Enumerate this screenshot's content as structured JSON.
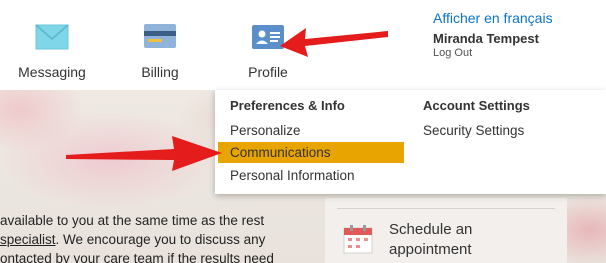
{
  "header": {
    "nav": [
      {
        "label": "Messaging",
        "icon": "envelope-icon"
      },
      {
        "label": "Billing",
        "icon": "credit-card-icon"
      },
      {
        "label": "Profile",
        "icon": "id-card-icon"
      }
    ],
    "language_link": "Afficher en français",
    "user_name": "Miranda Tempest",
    "logout": "Log Out"
  },
  "dropdown": {
    "preferences_heading": "Preferences & Info",
    "account_heading": "Account Settings",
    "preferences_items": [
      "Personalize",
      "Communications",
      "Personal Information"
    ],
    "account_items": [
      "Security Settings"
    ],
    "highlighted_item": "Communications"
  },
  "content": {
    "line1": "available to you at the same time as the rest",
    "line2_link": "specialist",
    "line2_rest": ". We encourage you to discuss any",
    "line3": "ontacted by your care team if the results need"
  },
  "side_panel": {
    "schedule_label": "Schedule an appointment",
    "schedule_icon": "calendar-icon"
  },
  "colors": {
    "accent_link": "#0a73c9",
    "highlight": "#e8a400",
    "annotation_arrow": "#e41c1c"
  },
  "annotations": [
    "arrow-icon",
    "arrow-icon"
  ]
}
